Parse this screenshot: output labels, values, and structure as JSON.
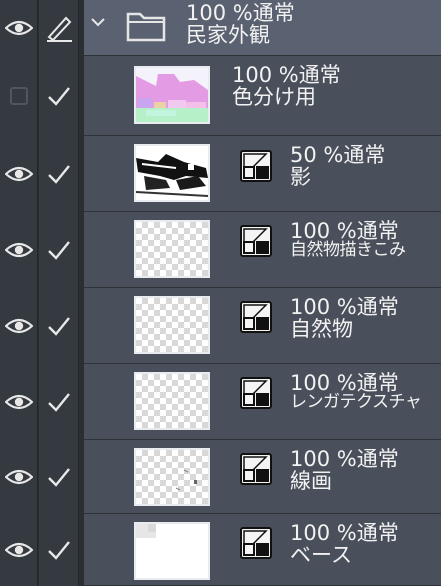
{
  "layers": [
    {
      "type": "folder",
      "opacity": "100 %通常",
      "name": "民家外観",
      "visible": true,
      "expanded": true
    },
    {
      "type": "layer",
      "opacity": "100 %通常",
      "name": "色分け用",
      "visible": false,
      "thumb": "color"
    },
    {
      "type": "layer",
      "opacity": "50 %通常",
      "name": "影",
      "visible": true,
      "thumb": "shadow",
      "blend_icon": "layer-mask-icon"
    },
    {
      "type": "layer",
      "opacity": "100 %通常",
      "name": "自然物描きこみ",
      "visible": true,
      "thumb": "checker",
      "blend_icon": "layer-mask-icon"
    },
    {
      "type": "layer",
      "opacity": "100 %通常",
      "name": "自然物",
      "visible": true,
      "thumb": "checker",
      "blend_icon": "layer-mask-icon"
    },
    {
      "type": "layer",
      "opacity": "100 %通常",
      "name": "レンガテクスチャ",
      "visible": true,
      "thumb": "checker",
      "blend_icon": "layer-mask-icon"
    },
    {
      "type": "layer",
      "opacity": "100 %通常",
      "name": "線画",
      "visible": true,
      "thumb": "checker",
      "blend_icon": "layer-mask-icon"
    },
    {
      "type": "layer",
      "opacity": "100 %通常",
      "name": "ベース",
      "visible": true,
      "thumb": "base",
      "blend_icon": "layer-mask-icon"
    }
  ],
  "colors": {
    "panel_bg": "#2b2e33",
    "column_bg": "#353a40",
    "row_bg": "#4a505b",
    "folder_bg": "#5a6170",
    "text": "#f2f2f2",
    "icon": "#e8e8e8"
  }
}
